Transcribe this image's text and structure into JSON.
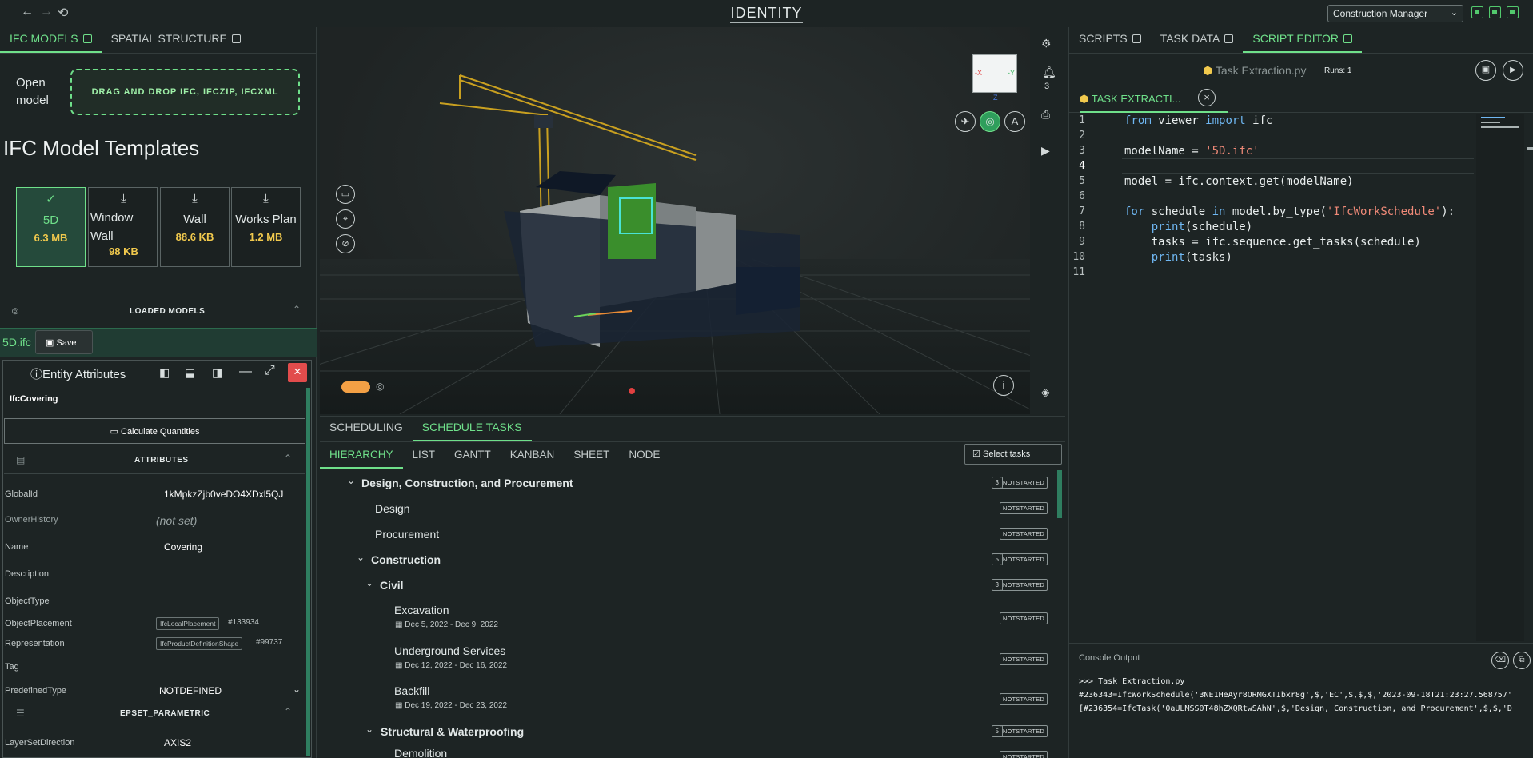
{
  "app": {
    "title": "IDENTITY",
    "role": "Construction Manager"
  },
  "left": {
    "tabs": [
      {
        "label": "IFC MODELS"
      },
      {
        "label": "SPATIAL STRUCTURE"
      }
    ],
    "open_model_label": "Open model",
    "dropzone": "DRAG AND DROP IFC, IFCZIP, IFCXML",
    "templates_title": "IFC Model Templates",
    "templates": [
      {
        "name": "5D",
        "size": "6.3 MB"
      },
      {
        "name": "Window Wall",
        "size": "98 KB"
      },
      {
        "name": "Wall",
        "size": "88.6 KB"
      },
      {
        "name": "Works Plan",
        "size": "1.2 MB"
      }
    ],
    "loaded_models_label": "LOADED MODELS",
    "loaded_model": "5D.ifc",
    "save_label": "Save",
    "entity_title": "Entity Attributes",
    "entity_class": "IfcCovering",
    "calc_label": "Calculate Quantities",
    "attributes_label": "ATTRIBUTES",
    "attributes": [
      {
        "key": "GlobalId",
        "value": "1kMpkzZjb0veDO4XDxl5QJ"
      },
      {
        "key": "OwnerHistory",
        "value": "(not set)"
      },
      {
        "key": "Name",
        "value": "Covering"
      },
      {
        "key": "Description",
        "value": ""
      },
      {
        "key": "ObjectType",
        "value": ""
      },
      {
        "key": "ObjectPlacement",
        "chip": "IfcLocalPlacement",
        "value": "#133934"
      },
      {
        "key": "Representation",
        "chip": "IfcProductDefinitionShape",
        "value": "#99737"
      },
      {
        "key": "Tag",
        "value": ""
      },
      {
        "key": "PredefinedType",
        "value": "NOTDEFINED"
      }
    ],
    "pset_label": "EPSET_PARAMETRIC",
    "pset": [
      {
        "key": "LayerSetDirection",
        "value": "AXIS2"
      }
    ]
  },
  "viewer": {
    "notifications": "3",
    "cube": {
      "x": "-X",
      "y": "-Y",
      "z": "-Z"
    }
  },
  "schedule": {
    "tabs": [
      "SCHEDULING",
      "SCHEDULE TASKS"
    ],
    "views": [
      "HIERARCHY",
      "LIST",
      "GANTT",
      "KANBAN",
      "SHEET",
      "NODE"
    ],
    "select_tasks": "Select tasks",
    "tasks": [
      {
        "name": "Design, Construction, and Procurement",
        "count": "3",
        "status": "NOTSTARTED"
      },
      {
        "name": "Design",
        "status": "NOTSTARTED"
      },
      {
        "name": "Procurement",
        "status": "NOTSTARTED"
      },
      {
        "name": "Construction",
        "count": "5",
        "status": "NOTSTARTED"
      },
      {
        "name": "Civil",
        "count": "3",
        "status": "NOTSTARTED"
      },
      {
        "name": "Excavation",
        "date": "Dec 5, 2022 - Dec 9, 2022",
        "status": "NOTSTARTED"
      },
      {
        "name": "Underground Services",
        "date": "Dec 12, 2022 - Dec 16, 2022",
        "status": "NOTSTARTED"
      },
      {
        "name": "Backfill",
        "date": "Dec 19, 2022 - Dec 23, 2022",
        "status": "NOTSTARTED"
      },
      {
        "name": "Structural & Waterproofing",
        "count": "5",
        "status": "NOTSTARTED"
      },
      {
        "name": "Demolition",
        "status": "NOTSTARTED"
      }
    ]
  },
  "right": {
    "tabs": [
      {
        "label": "SCRIPTS"
      },
      {
        "label": "TASK DATA"
      },
      {
        "label": "SCRIPT EDITOR"
      }
    ],
    "file_name": "Task Extraction.py",
    "runs": "Runs: 1",
    "file_tab": "TASK EXTRACTI...",
    "code": [
      "from viewer import ifc",
      "",
      "modelName = '5D.ifc'",
      "",
      "model = ifc.context.get(modelName)",
      "",
      "for schedule in model.by_type('IfcWorkSchedule'):",
      "    print(schedule)",
      "    tasks = ifc.sequence.get_tasks(schedule)",
      "    print(tasks)",
      ""
    ],
    "console_title": "Console Output",
    "console": [
      ">>> Task Extraction.py",
      "#236343=IfcWorkSchedule('3NE1HeAyr8ORMGXTIbxr8g',$,'EC',$,$,$,'2023-09-18T21:23:27.568757'",
      "[#236354=IfcTask('0aULMSS0T48hZXQRtwSAhN',$,'Design, Construction, and Procurement',$,$,'D"
    ]
  }
}
